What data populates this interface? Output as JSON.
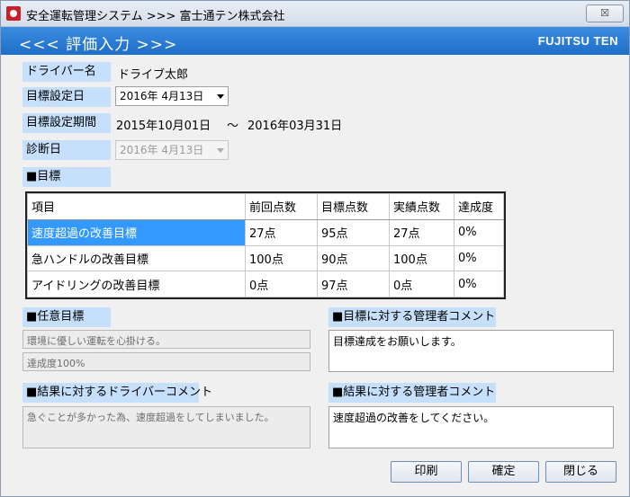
{
  "window": {
    "title": "安全運転管理システム >>> 富士通テン株式会社",
    "close_label": "☒"
  },
  "banner": {
    "title": "<<< 評価入力 >>>",
    "logo": "FUJITSU TEN"
  },
  "fields": {
    "driver_label": "ドライバー名",
    "driver_value": "ドライブ太郎",
    "target_date_label": "目標設定日",
    "target_date_value": "2016年  4月13日",
    "period_label": "目標設定期間",
    "period_start": "2015年10月01日",
    "period_sep": "～",
    "period_end": "2016年03月31日",
    "diagnosis_label": "診断日",
    "diagnosis_value": "2016年  4月13日"
  },
  "goals": {
    "section_label": "■目標",
    "columns": [
      "項目",
      "前回点数",
      "目標点数",
      "実績点数",
      "達成度"
    ],
    "rows": [
      [
        "速度超過の改善目標",
        "27点",
        "95点",
        "27点",
        "0%"
      ],
      [
        "急ハンドルの改善目標",
        "100点",
        "90点",
        "100点",
        "0%"
      ],
      [
        "アイドリングの改善目標",
        "0点",
        "97点",
        "0点",
        "0%"
      ]
    ]
  },
  "optional": {
    "section_label": "■任意目標",
    "line1": "環境に優しい運転を心掛ける。",
    "line2": "達成度100%"
  },
  "manager_goal_comment": {
    "section_label": "■目標に対する管理者コメント",
    "text": "目標達成をお願いします。"
  },
  "driver_result_comment": {
    "section_label": "■結果に対するドライバーコメント",
    "text": "急ぐことが多かった為、速度超過をしてしまいました。"
  },
  "manager_result_comment": {
    "section_label": "■結果に対する管理者コメント",
    "text": "速度超過の改善をしてください。"
  },
  "buttons": {
    "print": "印刷",
    "confirm": "確定",
    "close": "閉じる"
  },
  "colors": {
    "banner": "#2a7bd4",
    "label_bg": "#c6e0fb",
    "selection": "#3399ff"
  }
}
